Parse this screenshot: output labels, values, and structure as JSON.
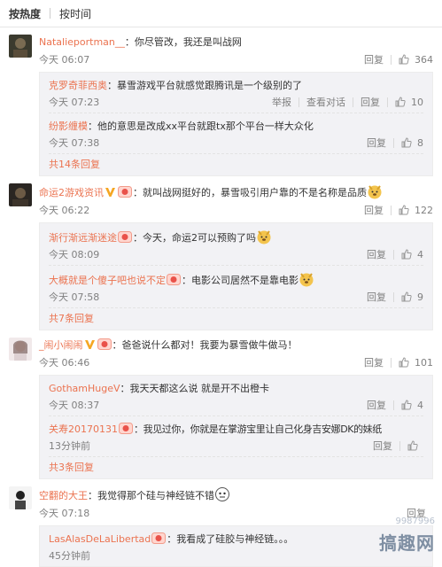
{
  "sort_tabs": [
    "按热度",
    "按时间"
  ],
  "comments": [
    {
      "user": "Natalieportman__",
      "text": "：你尽管改，我还是叫战网",
      "time": "今天 06:07",
      "reply_label": "回复",
      "likes": "364",
      "replies": [
        {
          "user": "克罗奇菲西奥",
          "text": "：暴雪游戏平台就感觉跟腾讯是一个级别的了",
          "time": "今天 07:23",
          "report": "举报",
          "view": "查看对话",
          "reply_label": "回复",
          "likes": "10"
        },
        {
          "user": "纷影缠模",
          "text": "：他的意思是改成xx平台就跟tx那个平台一样大众化",
          "time": "今天 07:38",
          "reply_label": "回复",
          "likes": "8"
        }
      ],
      "more": "共14条回复"
    },
    {
      "user": "命运2游戏资讯",
      "text": "：就叫战网挺好的，暴雪吸引用户靠的不是名称是品质",
      "time": "今天 06:22",
      "reply_label": "回复",
      "likes": "122",
      "replies": [
        {
          "user": "渐行渐远渐迷途",
          "text": "：今天，命运2可以预购了吗",
          "time": "今天 08:09",
          "reply_label": "回复",
          "likes": "4"
        },
        {
          "user": "大概就是个傻子吧也说不定",
          "text": "：电影公司居然不是靠电影",
          "time": "今天 07:58",
          "reply_label": "回复",
          "likes": "9"
        }
      ],
      "more": "共7条回复"
    },
    {
      "user": "_闹小闹闹",
      "text": "：爸爸说什么都对！我要为暴雪做牛做马！",
      "time": "今天 06:46",
      "reply_label": "回复",
      "likes": "101",
      "replies": [
        {
          "user": "GothamHugeV",
          "text": "：我天天都这么说 就是开不出橙卡",
          "time": "今天 08:37",
          "reply_label": "回复",
          "likes": "4"
        },
        {
          "user": "关寿20170131",
          "text": "：我见过你，你就是在掌游宝里让自己化身吉安娜DK的妹纸",
          "time": "13分钟前",
          "reply_label": "回复",
          "likes": ""
        }
      ],
      "more": "共3条回复"
    },
    {
      "user": "空翻的大王",
      "text": "：我觉得那个硅与神经链不错",
      "time": "今天 07:18",
      "reply_label": "回复",
      "likes": "",
      "replies": [
        {
          "user": "LasAlasDeLaLibertad",
          "text": "：我看成了硅胶与神经链。。。",
          "time": "45分钟前",
          "reply_label": "",
          "likes": ""
        }
      ],
      "more": ""
    }
  ],
  "watermark": {
    "small": "9987996",
    "text": "搞趣网"
  },
  "colors": {
    "username": "#eb7350",
    "reply_bg": "#f2f2f5",
    "meta": "#808080"
  }
}
